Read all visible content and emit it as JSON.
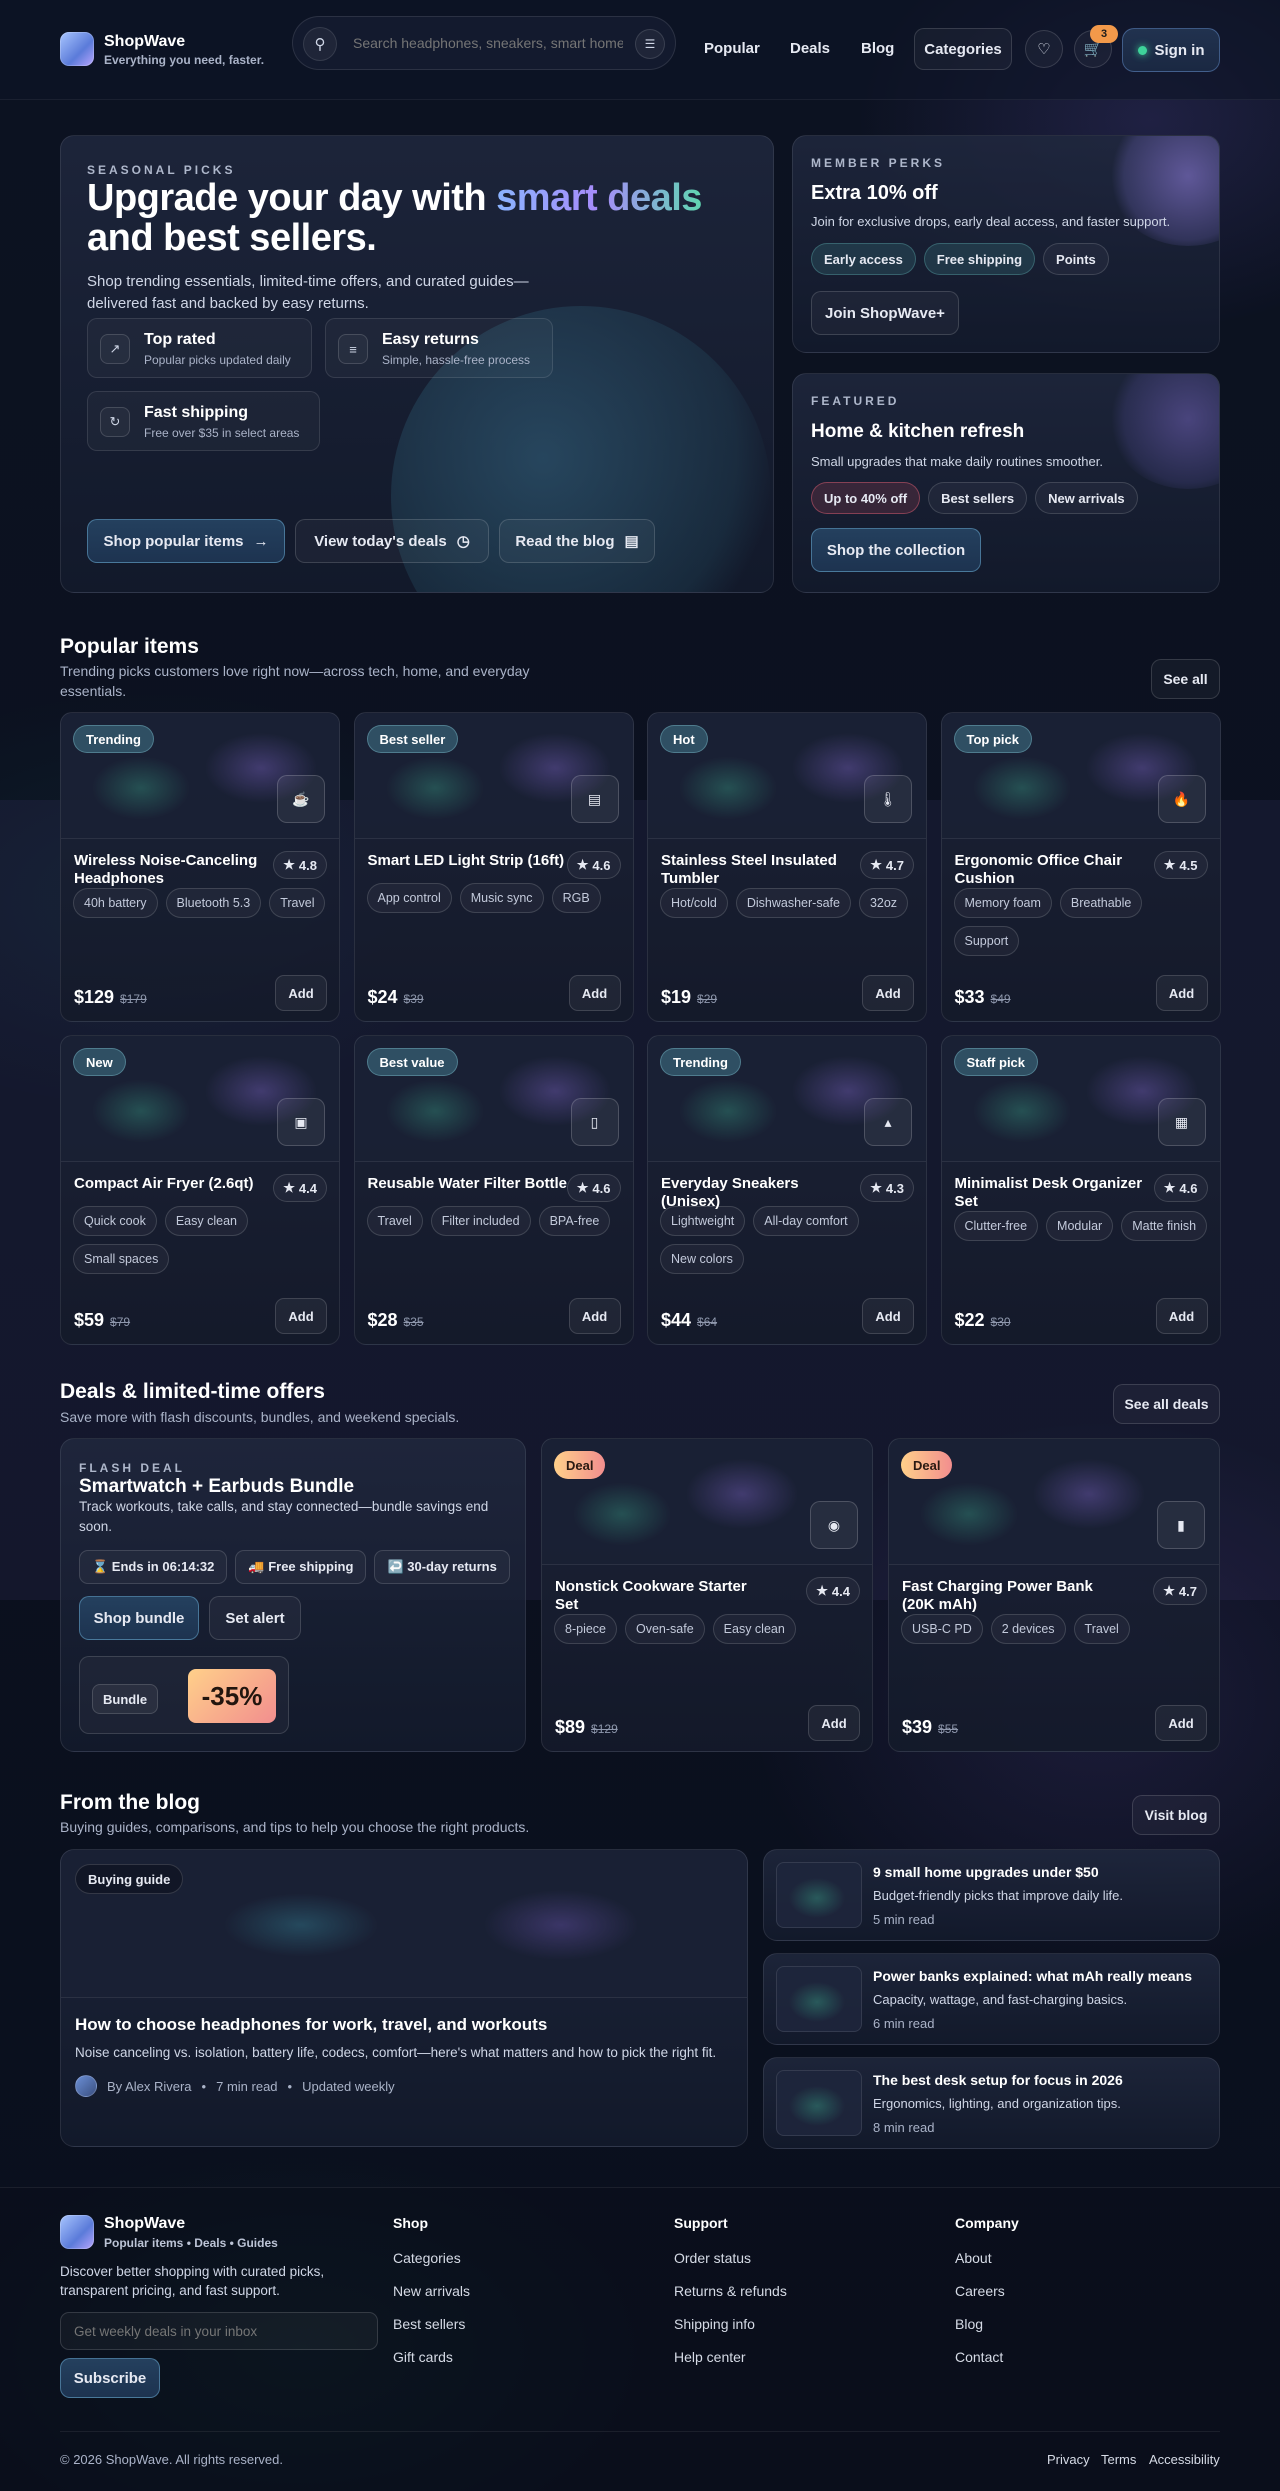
{
  "header": {
    "brand": "ShopWave",
    "tagline": "Everything you need, faster.",
    "search_placeholder": "Search headphones, sneakers, smart home...",
    "nav": [
      "Popular",
      "Deals",
      "Blog"
    ],
    "categories": "Categories",
    "cart_count": "3",
    "signin": "Sign in"
  },
  "hero": {
    "eyebrow": "SEASONAL PICKS",
    "title_a": "Upgrade your day with ",
    "title_accent": "smart deals",
    "title_b": " and best sellers.",
    "desc": "Shop trending essentials, limited-time offers, and curated guides—delivered fast and backed by easy returns.",
    "features": [
      {
        "title": "Top rated",
        "sub": "Popular picks updated daily",
        "icon": "trend-icon"
      },
      {
        "title": "Easy returns",
        "sub": "Simple, hassle-free process",
        "icon": "sliders-icon"
      },
      {
        "title": "Fast shipping",
        "sub": "Free over $35 in select areas",
        "icon": "refresh-icon"
      }
    ],
    "cta": [
      "Shop popular items",
      "View today's deals",
      "Read the blog"
    ]
  },
  "perks": {
    "eyebrow": "MEMBER PERKS",
    "title": "Extra 10% off",
    "desc": "Join for exclusive drops, early deal access, and faster support.",
    "pills": [
      "Early access",
      "Free shipping",
      "Points"
    ],
    "button": "Join ShopWave+"
  },
  "featured": {
    "eyebrow": "FEATURED",
    "title": "Home & kitchen refresh",
    "desc": "Small upgrades that make daily routines smoother.",
    "pills": [
      "Up to 40% off",
      "Best sellers",
      "New arrivals"
    ],
    "button": "Shop the collection"
  },
  "popular": {
    "title": "Popular items",
    "sub": "Trending picks customers love right now—across tech, home, and everyday essentials.",
    "see_all": "See all",
    "add": "Add",
    "items": [
      {
        "tag": "Trending",
        "icon": "bag-icon",
        "name": "Wireless Noise-Canceling Headphones",
        "rating": "4.8",
        "tags": [
          "40h battery",
          "Bluetooth 5.3",
          "Travel"
        ],
        "price": "$129",
        "old": "$179"
      },
      {
        "tag": "Best seller",
        "icon": "display-icon",
        "name": "Smart LED Light Strip (16ft)",
        "rating": "4.6",
        "tags": [
          "App control",
          "Music sync",
          "RGB"
        ],
        "price": "$24",
        "old": "$39"
      },
      {
        "tag": "Hot",
        "icon": "thermo-icon",
        "name": "Stainless Steel Insulated Tumbler",
        "rating": "4.7",
        "tags": [
          "Hot/cold",
          "Dishwasher-safe",
          "32oz"
        ],
        "price": "$19",
        "old": "$29"
      },
      {
        "tag": "Top pick",
        "icon": "flame-icon",
        "name": "Ergonomic Office Chair Cushion",
        "rating": "4.5",
        "tags": [
          "Memory foam",
          "Breathable",
          "Support"
        ],
        "price": "$33",
        "old": "$49"
      },
      {
        "tag": "New",
        "icon": "fryer-icon",
        "name": "Compact Air Fryer (2.6qt)",
        "rating": "4.4",
        "tags": [
          "Quick cook",
          "Easy clean",
          "Small spaces"
        ],
        "price": "$59",
        "old": "$79"
      },
      {
        "tag": "Best value",
        "icon": "bottle-icon",
        "name": "Reusable Water Filter Bottle",
        "rating": "4.6",
        "tags": [
          "Travel",
          "Filter included",
          "BPA-free"
        ],
        "price": "$28",
        "old": "$35"
      },
      {
        "tag": "Trending",
        "icon": "shoe-icon",
        "name": "Everyday Sneakers (Unisex)",
        "rating": "4.3",
        "tags": [
          "Lightweight",
          "All-day comfort",
          "New colors"
        ],
        "price": "$44",
        "old": "$64"
      },
      {
        "tag": "Staff pick",
        "icon": "organizer-icon",
        "name": "Minimalist Desk Organizer Set",
        "rating": "4.6",
        "tags": [
          "Clutter-free",
          "Modular",
          "Matte finish"
        ],
        "price": "$22",
        "old": "$30"
      }
    ]
  },
  "deals": {
    "title": "Deals & limited-time offers",
    "sub": "Save more with flash discounts, bundles, and weekend specials.",
    "see_all": "See all deals",
    "flash": {
      "eyebrow": "FLASH DEAL",
      "title": "Smartwatch + Earbuds Bundle",
      "desc": "Track workouts, take calls, and stay connected—bundle savings end soon.",
      "chips": [
        "⌛ Ends in 06:14:32",
        "🚚 Free shipping",
        "↩️ 30-day returns"
      ],
      "shop": "Shop bundle",
      "alert": "Set alert",
      "bundle": "Bundle",
      "discount": "-35%"
    },
    "items": [
      {
        "tag": "Deal",
        "icon": "pan-icon",
        "name": "Nonstick Cookware Starter Set",
        "rating": "4.4",
        "tags": [
          "8-piece",
          "Oven-safe",
          "Easy clean"
        ],
        "price": "$89",
        "old": "$129"
      },
      {
        "tag": "Deal",
        "icon": "battery-icon",
        "name": "Fast Charging Power Bank (20K mAh)",
        "rating": "4.7",
        "tags": [
          "USB-C PD",
          "2 devices",
          "Travel"
        ],
        "price": "$39",
        "old": "$55"
      }
    ]
  },
  "blog": {
    "title": "From the blog",
    "sub": "Buying guides, comparisons, and tips to help you choose the right products.",
    "visit": "Visit blog",
    "main": {
      "tag": "Buying guide",
      "title": "How to choose headphones for work, travel, and workouts",
      "desc": "Noise canceling vs. isolation, battery life, codecs, comfort—here's what matters and how to pick the right fit.",
      "author": "By Alex Rivera",
      "read": "7 min read",
      "updated": "Updated weekly"
    },
    "posts": [
      {
        "title": "9 small home upgrades under $50",
        "desc": "Budget-friendly picks that improve daily life.",
        "read": "5 min read"
      },
      {
        "title": "Power banks explained: what mAh really means",
        "desc": "Capacity, wattage, and fast-charging basics.",
        "read": "6 min read"
      },
      {
        "title": "The best desk setup for focus in 2026",
        "desc": "Ergonomics, lighting, and organization tips.",
        "read": "8 min read"
      }
    ]
  },
  "footer": {
    "brand": "ShopWave",
    "tagline": "Popular items • Deals • Guides",
    "desc": "Discover better shopping with curated picks, transparent pricing, and fast support.",
    "email_placeholder": "Get weekly deals in your inbox",
    "subscribe": "Subscribe",
    "cols": [
      {
        "title": "Shop",
        "links": [
          "Categories",
          "New arrivals",
          "Best sellers",
          "Gift cards"
        ]
      },
      {
        "title": "Support",
        "links": [
          "Order status",
          "Returns & refunds",
          "Shipping info",
          "Help center"
        ]
      },
      {
        "title": "Company",
        "links": [
          "About",
          "Careers",
          "Blog",
          "Contact"
        ]
      }
    ],
    "copyright": "© 2026 ShopWave. All rights reserved.",
    "legal": [
      "Privacy",
      "Terms",
      "Accessibility"
    ]
  }
}
